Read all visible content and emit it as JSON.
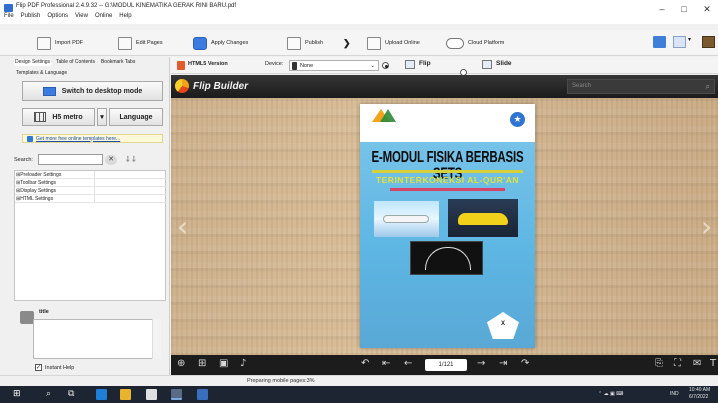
{
  "window": {
    "title": "Flip PDF Professional 2.4.9.32 -- G:\\MODUL KINEMATIKA GERAK RINI BARU.pdf",
    "menu": [
      "File",
      "Publish",
      "Options",
      "View",
      "Online",
      "Help"
    ],
    "controls": {
      "minimize": "–",
      "maximize": "□",
      "close": "✕"
    }
  },
  "toolbar": {
    "import_pdf": "Import PDF",
    "edit_pages": "Edit Pages",
    "apply_changes": "Apply Changes",
    "publish": "Publish",
    "upload_online": "Upload Online",
    "cloud_platform": "Cloud Platform",
    "publish_arrow": "❯"
  },
  "left_panel": {
    "tabs": [
      "Design Settings",
      "Table of Contents",
      "Bookmark Tabs"
    ],
    "tab_row2": "Templates & Language",
    "switch_desktop": "Switch to desktop mode",
    "template_name": "H5 metro",
    "template_arrow": "▾",
    "language_button": "Language",
    "more_templates_link": "Get more free online templates here...",
    "search_label": "Search:",
    "search_value": "",
    "search_clear": "✕",
    "tree_tools": "⸸ ⸸",
    "tree_items": [
      "⊞Preloader Settings",
      "⊞Toolbar Settings",
      "⊞Display Settings",
      "⊞HTML Settings"
    ],
    "help_title": "title",
    "instant_help_label": "Instant Help",
    "instant_help_checked": "✓"
  },
  "preview_bar": {
    "html5_version": "HTML5 Version",
    "device_label": "Device:",
    "device_value": "None",
    "device_arrow": "⌄",
    "flip_label": "Flip",
    "slide_label": "Slide"
  },
  "viewer": {
    "brand": "Flip Builder",
    "search_placeholder": "Search",
    "search_icon": "⌕",
    "prev_arrow": "‹",
    "next_arrow": "›",
    "cover": {
      "title": "E-MODUL FISIKA BERBASIS SETS",
      "subtitle": "TERINTERKONEKSI AL-QUR'AN",
      "badge": "X",
      "corner_icon": "★"
    },
    "page_indicator": "1/121",
    "bottom_icons_left": [
      "⊕",
      "⊞",
      "▣",
      "♪"
    ],
    "bottom_icons_mid": [
      "↶",
      "⇤",
      "←",
      "→",
      "⇥",
      "↷"
    ],
    "bottom_icons_right": [
      "⎘",
      "⛶",
      "✉",
      "T"
    ]
  },
  "status": {
    "text": "Preparing mobile pages:3%"
  },
  "taskbar": {
    "start": "⊞",
    "search": "⌕",
    "task_view": "⧉",
    "tray_text": "IND",
    "time": "10:40 AM",
    "date": "6/7/2022",
    "tray_icons": "⌃ ☁ ▣ ⌨"
  }
}
